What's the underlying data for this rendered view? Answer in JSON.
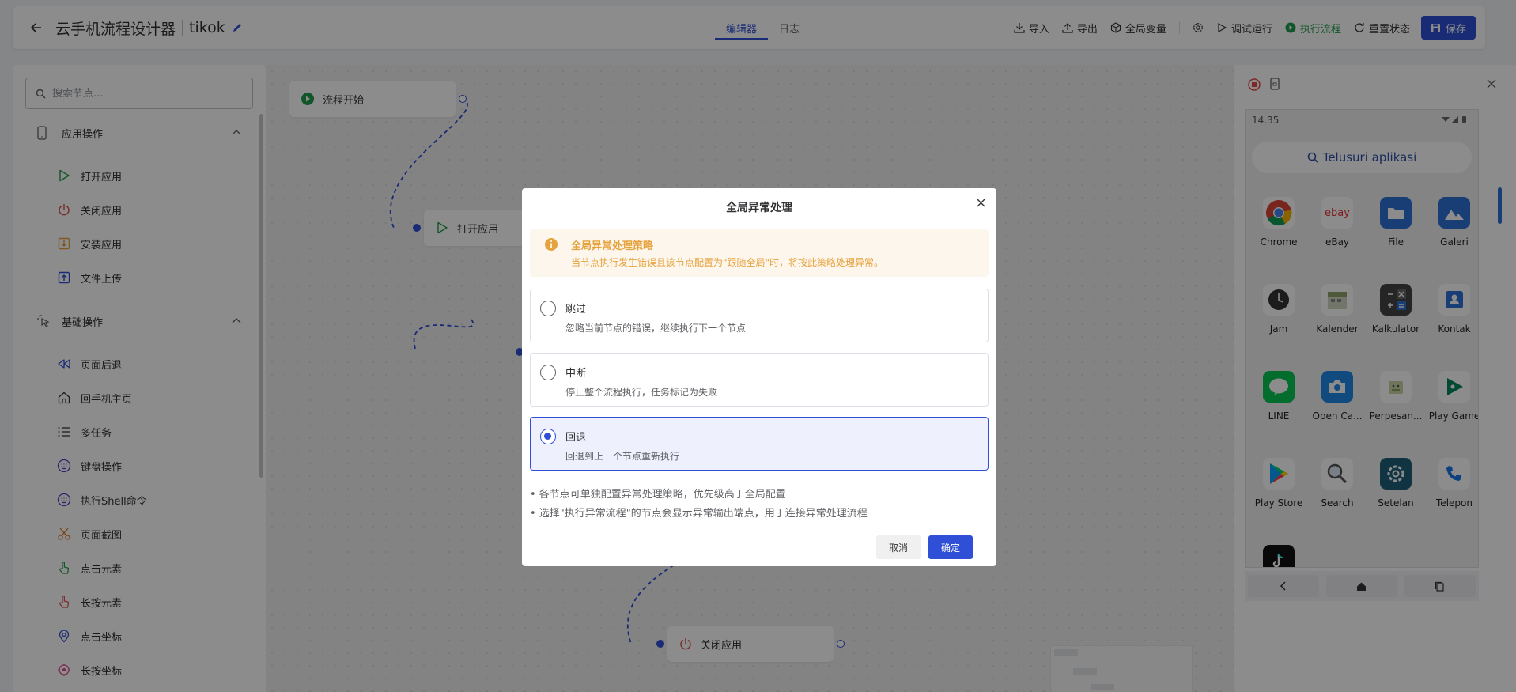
{
  "header": {
    "app_title": "云手机流程设计器",
    "flow_name": "tikok",
    "tabs": [
      {
        "label": "编辑器"
      },
      {
        "label": "日志"
      }
    ],
    "actions": {
      "import": "导入",
      "export": "导出",
      "global_vars": "全局变量",
      "debug_run": "调试运行",
      "execute_flow": "执行流程",
      "reset_state": "重置状态",
      "save": "保存"
    }
  },
  "sidebar": {
    "search_placeholder": "搜索节点...",
    "sections": [
      {
        "title": "应用操作",
        "items": [
          "打开应用",
          "关闭应用",
          "安装应用",
          "文件上传"
        ]
      },
      {
        "title": "基础操作",
        "items": [
          "页面后退",
          "回手机主页",
          "多任务",
          "键盘操作",
          "执行Shell命令",
          "页面截图",
          "点击元素",
          "长按元素",
          "点击坐标",
          "长按坐标"
        ]
      }
    ]
  },
  "canvas": {
    "nodes": {
      "start": "流程开始",
      "open_app": "打开应用",
      "close_app": "关闭应用"
    }
  },
  "device": {
    "status_time": "14.35",
    "search_label": "Telusuri aplikasi",
    "apps": [
      "Chrome",
      "eBay",
      "File",
      "Galeri",
      "Jam",
      "Kalender",
      "Kalkulator",
      "Kontak",
      "LINE",
      "Open Ca...",
      "Perpesan...",
      "Play Game",
      "Play Store",
      "Search",
      "Setelan",
      "Telepon"
    ],
    "ebay_logo": "ebay"
  },
  "modal": {
    "title": "全局异常处理",
    "warning_title": "全局异常处理策略",
    "warning_desc": "当节点执行发生错误且该节点配置为\"跟随全局\"时，将按此策略处理异常。",
    "options": [
      {
        "label": "跳过",
        "desc": "忽略当前节点的错误，继续执行下一个节点"
      },
      {
        "label": "中断",
        "desc": "停止整个流程执行，任务标记为失败"
      },
      {
        "label": "回退",
        "desc": "回退到上一个节点重新执行"
      }
    ],
    "selected_option": "回退",
    "tips": [
      "• 各节点可单独配置异常处理策略，优先级高于全局配置",
      "• 选择\"执行异常流程\"的节点会显示异常输出端点，用于连接异常处理流程"
    ],
    "cancel": "取消",
    "confirm": "确定"
  },
  "colors": {
    "primary": "#2f4fd6",
    "success": "#1f9d4b",
    "warning": "#e6a23c",
    "danger": "#e04b4b"
  }
}
